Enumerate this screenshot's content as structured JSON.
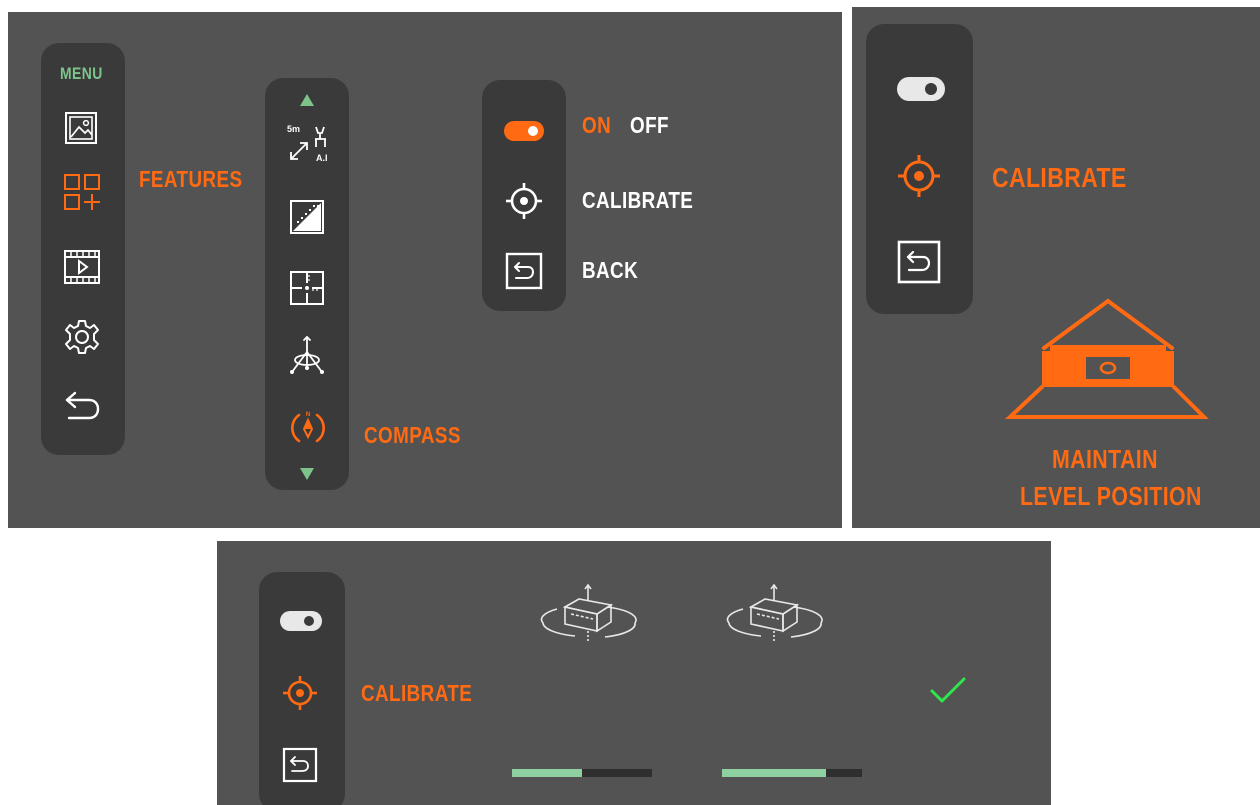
{
  "colors": {
    "panel_bg": "#535353",
    "rail_bg": "#3a3a3a",
    "accent": "#ff6a13",
    "menu_green": "#7cc48a",
    "check_green": "#2ee84a",
    "progress_fill": "#8ed0a0",
    "text": "#ffffff"
  },
  "panel1": {
    "menu_title": "MENU",
    "menu_icons": [
      "gallery-icon",
      "features-grid-plus-icon",
      "video-icon",
      "gear-icon",
      "back-arrow-icon"
    ],
    "features_label": "FEATURES",
    "feature_icons": [
      "scroll-up-arrow-icon",
      "ai-rangefinder-deer-icon",
      "pixel-gradient-icon",
      "crosshair-grid-icon",
      "tripod-icon",
      "compass-icon",
      "scroll-down-arrow-icon"
    ],
    "ai_icon_range": "5m",
    "ai_icon_tag": "A.I",
    "compass_label": "COMPASS",
    "options": {
      "on": "ON",
      "off": "OFF",
      "calibrate": "CALIBRATE",
      "back": "BACK"
    }
  },
  "panel2": {
    "calibrate": "CALIBRATE",
    "level_line1": "MAINTAIN",
    "level_line2": "LEVEL POSITION"
  },
  "panel3": {
    "calibrate": "CALIBRATE",
    "progress": [
      0.5,
      0.74
    ],
    "status_icon": "checkmark-icon"
  }
}
